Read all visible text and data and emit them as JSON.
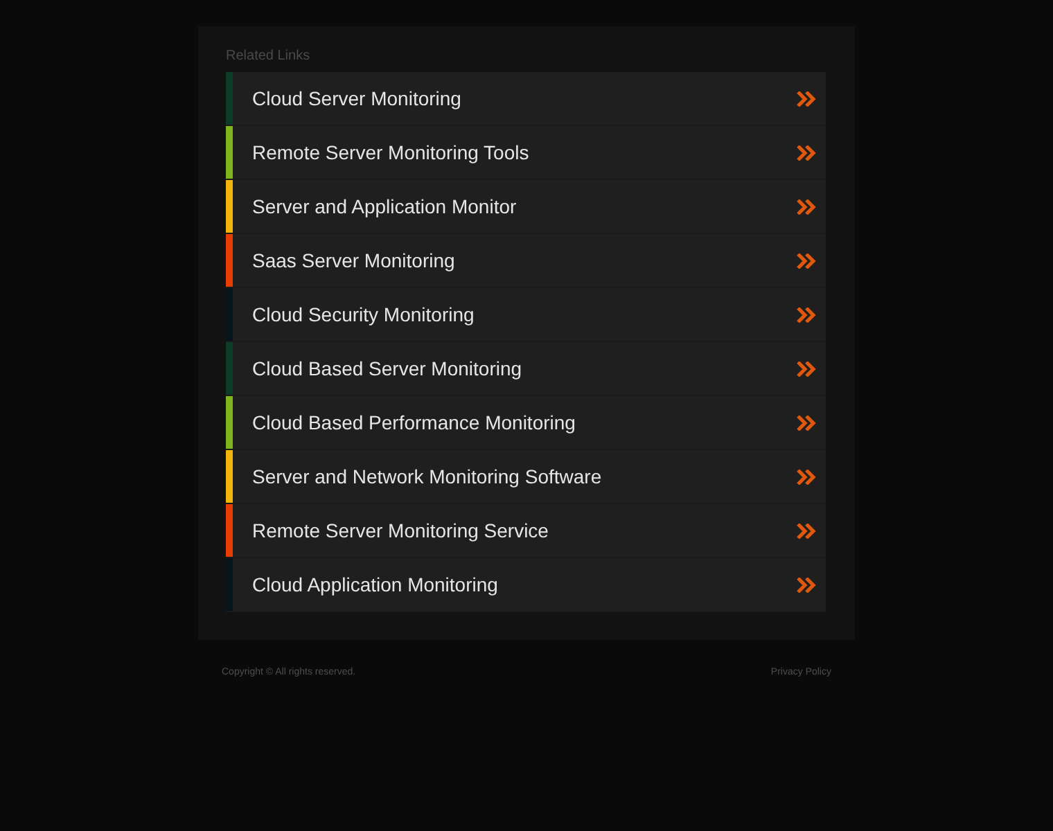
{
  "heading": "Related Links",
  "links": [
    {
      "label": "Cloud Server Monitoring",
      "color": "#0d3b27"
    },
    {
      "label": "Remote Server Monitoring Tools",
      "color": "#7fb41b"
    },
    {
      "label": "Server and Application Monitor",
      "color": "#f2b50a"
    },
    {
      "label": "Saas Server Monitoring",
      "color": "#e83d02"
    },
    {
      "label": "Cloud Security Monitoring",
      "color": "#08141b"
    },
    {
      "label": "Cloud Based Server Monitoring",
      "color": "#0d3b27"
    },
    {
      "label": "Cloud Based Performance Monitoring",
      "color": "#7fb41b"
    },
    {
      "label": "Server and Network Monitoring Software",
      "color": "#f2b50a"
    },
    {
      "label": "Remote Server Monitoring Service",
      "color": "#e83d02"
    },
    {
      "label": "Cloud Application Monitoring",
      "color": "#08141b"
    }
  ],
  "footer": {
    "copyright": "Copyright ©  All rights reserved.",
    "privacy": "Privacy Policy"
  }
}
